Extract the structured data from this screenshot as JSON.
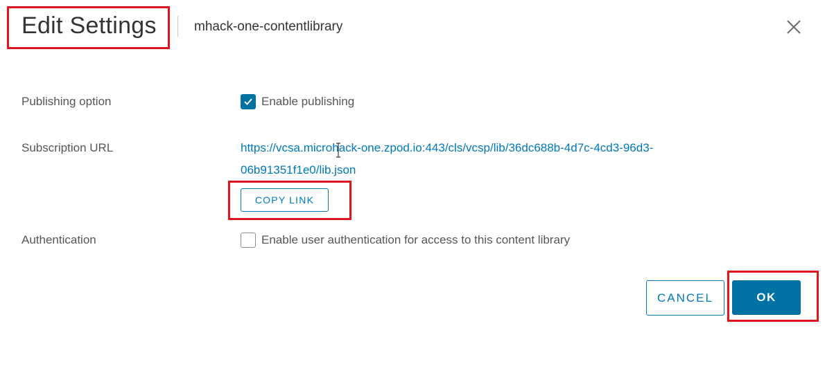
{
  "dialog": {
    "title": "Edit Settings",
    "subtitle": "mhack-one-contentlibrary",
    "close_icon": "close-icon"
  },
  "publishing": {
    "label": "Publishing option",
    "checkbox_label": "Enable publishing",
    "checked": true
  },
  "subscription": {
    "label": "Subscription URL",
    "url_line1": "https://vcsa.microhack-one.zpod.io:443/cls/vcsp/lib/36dc688b-4d7c-4cd3-96d3-",
    "url_line2": "06b91351f1e0/lib.json",
    "copy_button": "COPY LINK"
  },
  "authentication": {
    "label": "Authentication",
    "checkbox_label": "Enable user authentication for access to this content library",
    "checked": false
  },
  "footer": {
    "cancel_label": "CANCEL",
    "ok_label": "OK"
  },
  "colors": {
    "accent": "#0072a3",
    "link": "#0079b8",
    "annotation": "#e0141e"
  }
}
